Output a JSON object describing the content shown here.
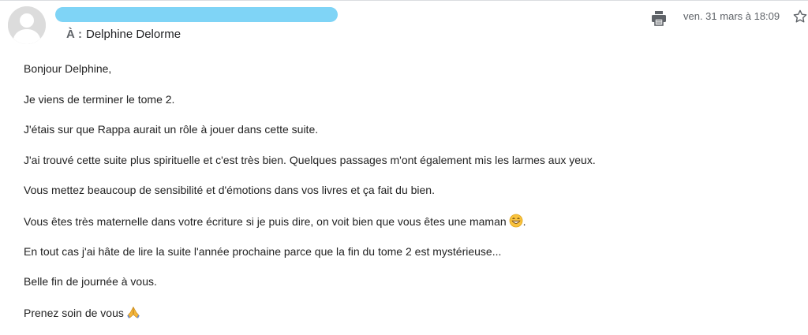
{
  "email": {
    "recipient_prefix": "À :",
    "recipient_name": "Delphine Delorme",
    "date": "ven. 31 mars à 18:09",
    "icons": {
      "avatar": "default-avatar-icon",
      "print": "print-icon",
      "star": "star-outline-icon"
    },
    "redaction_color": "#7fd4f6"
  },
  "body": {
    "greeting": "Bonjour Delphine,",
    "lines": [
      "Je viens de terminer le tome 2.",
      "J'étais sur que Rappa aurait un rôle à jouer dans cette suite.",
      "J'ai trouvé cette suite plus spirituelle et c'est très bien. Quelques passages m'ont également mis les larmes aux yeux.",
      "Vous mettez beaucoup de sensibilité et d'émotions dans vos livres et ça fait du bien.",
      "Vous êtes très maternelle dans votre écriture si je puis dire, on voit bien que vous êtes une maman",
      "En tout cas j'ai hâte de lire la suite l'année prochaine parce que la fin du tome 2 est mystérieuse...",
      "Belle fin de journée à vous.",
      "Prenez soin de vous"
    ],
    "line5_suffix": ".",
    "emojis": {
      "grin": "grinning-emoji-icon",
      "pray": "folded-hands-emoji-icon"
    }
  }
}
